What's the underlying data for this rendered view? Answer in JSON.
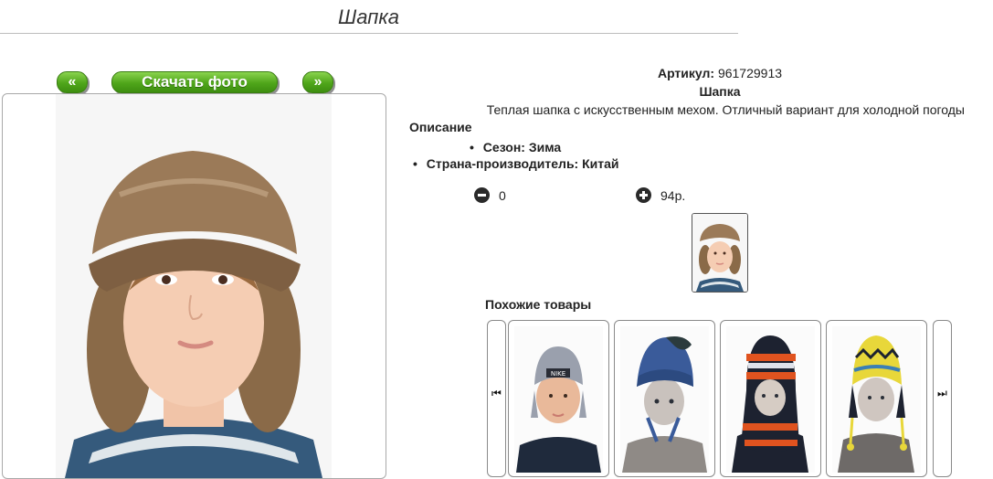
{
  "page": {
    "title": "Шапка"
  },
  "photo_nav": {
    "prev_label": "«",
    "download_label": "Скачать фото",
    "next_label": "»"
  },
  "product": {
    "article_label": "Артикул:",
    "article_value": "961729913",
    "name": "Шапка",
    "description_text": "Теплая шапка с искусственным мехом. Отличный вариант для холодной погоды",
    "description_label": "Описание",
    "attributes": [
      {
        "label": "Сезон:",
        "value": "Зима"
      },
      {
        "label": "Страна-производитель:",
        "value": "Китай"
      }
    ],
    "quantity": "0",
    "price": "94р."
  },
  "similar": {
    "title": "Похожие товары",
    "items": [
      {
        "kind": "grey-hat-child",
        "hat_text": "NIKE"
      },
      {
        "kind": "blue-hat-mannequin"
      },
      {
        "kind": "striped-balaclava-mannequin"
      },
      {
        "kind": "yellow-earflap-mannequin"
      }
    ],
    "icons": {
      "prev": "skip-back-icon",
      "next": "skip-forward-icon"
    }
  },
  "colors": {
    "accent": "#4fa51a",
    "border": "#8a8a8a"
  }
}
